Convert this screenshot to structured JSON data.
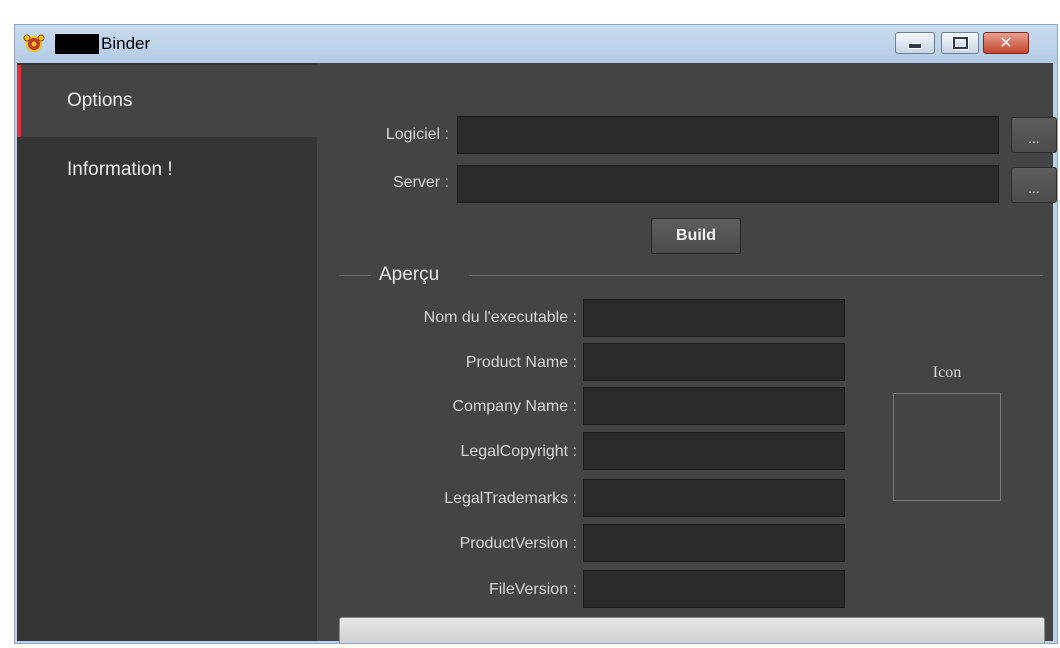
{
  "window": {
    "title": "Binder"
  },
  "sidebar": {
    "items": [
      {
        "label": "Options"
      },
      {
        "label": "Information !"
      }
    ]
  },
  "form": {
    "logiciel": {
      "label": "Logiciel :",
      "value": "",
      "browse": "..."
    },
    "server": {
      "label": "Server :",
      "value": "",
      "browse": "..."
    },
    "build_label": "Build"
  },
  "apercu": {
    "title": "Aperçu",
    "icon_label": "Icon",
    "fields": [
      {
        "label": "Nom du l'executable :",
        "value": ""
      },
      {
        "label": "Product Name :",
        "value": ""
      },
      {
        "label": "Company Name :",
        "value": ""
      },
      {
        "label": "LegalCopyright :",
        "value": ""
      },
      {
        "label": "LegalTrademarks :",
        "value": ""
      },
      {
        "label": "ProductVersion :",
        "value": ""
      },
      {
        "label": "FileVersion :",
        "value": ""
      }
    ]
  },
  "progress": {
    "value": 0
  },
  "colors": {
    "accent": "#e53030",
    "background": "#444444",
    "sidebar": "#353535",
    "input": "#2a2a2a"
  },
  "icons": {
    "app": "app-icon",
    "minimize": "minimize-icon",
    "maximize": "maximize-icon",
    "close": "close-icon"
  }
}
